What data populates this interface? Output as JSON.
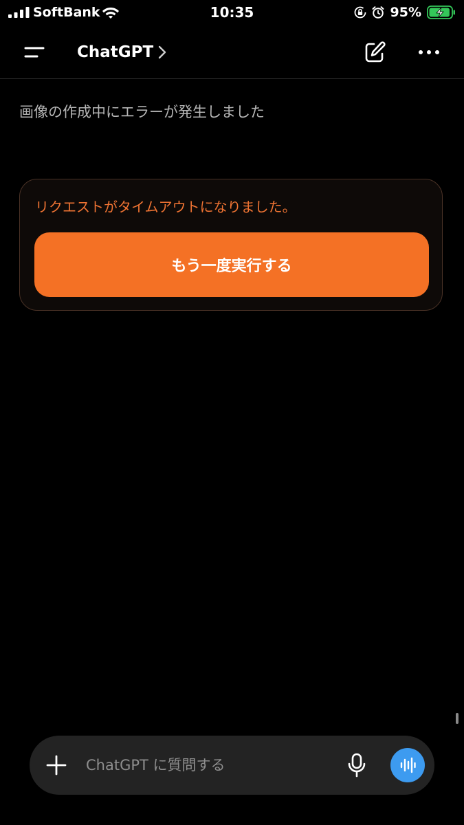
{
  "status_bar": {
    "carrier": "SoftBank",
    "time": "10:35",
    "battery_percent": "95%",
    "battery_level": 0.95,
    "charging": true,
    "icons": [
      "signal-icon",
      "wifi-icon",
      "rotation-lock-icon",
      "alarm-icon",
      "battery-charging-icon"
    ]
  },
  "nav": {
    "title": "ChatGPT",
    "icons": [
      "menu-icon",
      "chevron-right-icon",
      "compose-icon",
      "more-icon"
    ]
  },
  "content": {
    "error_message": "画像の作成中にエラーが発生しました",
    "error_card": {
      "text": "リクエストがタイムアウトになりました。",
      "retry_label": "もう一度実行する"
    }
  },
  "composer": {
    "placeholder": "ChatGPT に質問する",
    "value": "",
    "icons": [
      "plus-icon",
      "microphone-icon",
      "voice-wave-icon"
    ]
  },
  "colors": {
    "background": "#000000",
    "accent_orange": "#f47125",
    "error_text": "#f07433",
    "voice_blue": "#3d9bf0",
    "battery_green": "#34c759"
  }
}
